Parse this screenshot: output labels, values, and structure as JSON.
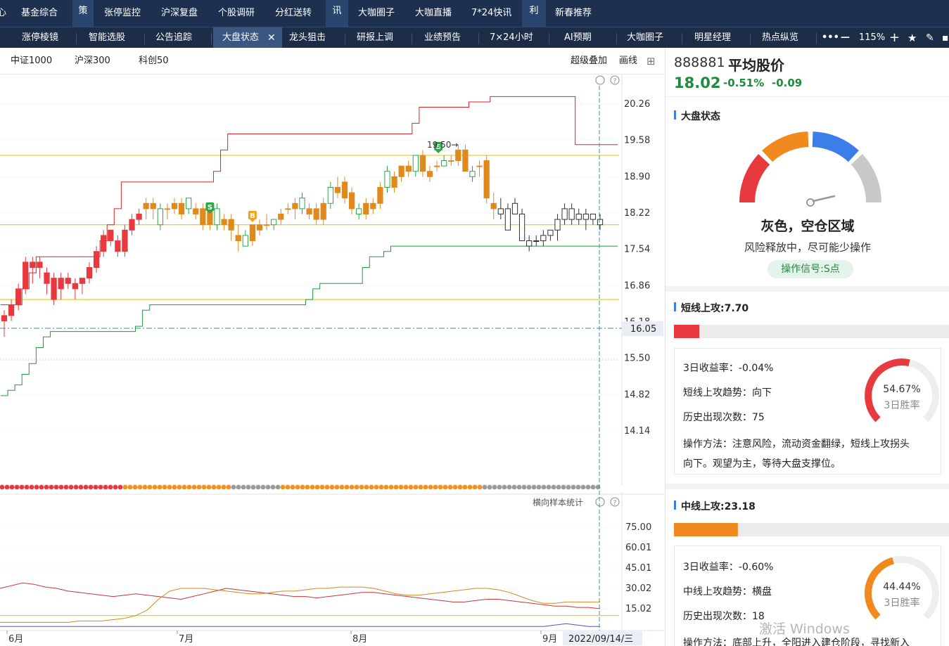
{
  "top_nav": {
    "cut_left": "心",
    "items": [
      "基金综合",
      "张停监控",
      "沪深复盘",
      "个股调研",
      "分红送转",
      "大咖圈子",
      "大咖直播",
      "7*24快讯",
      "新春推荐"
    ],
    "groups": [
      "策",
      "讯",
      "利"
    ]
  },
  "sub_nav": {
    "tabs": [
      "涨停棱镜",
      "智能选股",
      "公告追踪",
      "大盘状态",
      "龙头狙击",
      "研报上调",
      "业绩预告",
      "7×24小时",
      "AI预期",
      "大咖圈子",
      "明星经理",
      "热点纵览"
    ],
    "active_tab": "大盘状态",
    "more": "•••",
    "zoom_out": "—",
    "zoom": "115%",
    "zoom_in": "+"
  },
  "index_bar": {
    "indices": [
      "中证1000",
      "沪深300",
      "科创50"
    ],
    "overlay": "超级叠加",
    "draw": "画线"
  },
  "chart_data": [
    {
      "type": "candlestick",
      "ylim": [
        14.0,
        20.6
      ],
      "y_ticks": [
        "20.26",
        "19.58",
        "18.90",
        "18.22",
        "17.54",
        "16.86",
        "16.18",
        "15.50",
        "14.82",
        "14.14"
      ],
      "current_price_label": "16.05",
      "peak_annotation": "19.50→",
      "signals": [
        "S",
        "B",
        "S"
      ],
      "ohlc": [
        [
          16.2,
          16.4,
          15.9,
          16.3
        ],
        [
          16.3,
          16.6,
          16.2,
          16.5
        ],
        [
          16.5,
          16.9,
          16.4,
          16.8
        ],
        [
          16.8,
          17.4,
          16.7,
          17.3
        ],
        [
          17.3,
          17.4,
          16.9,
          17.2
        ],
        [
          17.3,
          17.4,
          17.0,
          17.2
        ],
        [
          17.1,
          17.2,
          16.7,
          16.9
        ],
        [
          17.0,
          17.1,
          16.5,
          16.6
        ],
        [
          16.8,
          17.1,
          16.6,
          17.0
        ],
        [
          17.0,
          17.1,
          16.8,
          16.9
        ],
        [
          16.9,
          17.0,
          16.6,
          16.8
        ],
        [
          16.9,
          17.0,
          16.7,
          17.0
        ],
        [
          17.0,
          17.3,
          16.9,
          17.2
        ],
        [
          17.2,
          17.6,
          17.1,
          17.5
        ],
        [
          17.5,
          17.9,
          17.4,
          17.8
        ],
        [
          17.9,
          17.9,
          17.6,
          17.7
        ],
        [
          17.7,
          17.8,
          17.4,
          17.5
        ],
        [
          17.5,
          18.0,
          17.4,
          17.9
        ],
        [
          17.9,
          18.2,
          17.8,
          18.1
        ],
        [
          18.1,
          18.3,
          18.0,
          18.2
        ],
        [
          18.3,
          18.5,
          18.1,
          18.4
        ],
        [
          18.4,
          18.5,
          18.1,
          18.3
        ],
        [
          18.0,
          18.4,
          17.9,
          18.3
        ],
        [
          18.3,
          18.4,
          18.1,
          18.3
        ],
        [
          18.3,
          18.5,
          18.2,
          18.4
        ],
        [
          18.4,
          18.5,
          18.1,
          18.2
        ],
        [
          18.3,
          18.5,
          18.2,
          18.5
        ],
        [
          18.3,
          18.4,
          18.1,
          18.2
        ],
        [
          18.0,
          18.4,
          17.9,
          18.3
        ],
        [
          18.3,
          18.4,
          17.9,
          18.0
        ],
        [
          18.0,
          18.4,
          17.9,
          18.3
        ],
        [
          18.1,
          18.2,
          17.9,
          18.0
        ],
        [
          18.1,
          18.2,
          17.7,
          17.9
        ],
        [
          17.8,
          18.0,
          17.5,
          17.7
        ],
        [
          17.6,
          17.9,
          17.6,
          17.8
        ],
        [
          17.7,
          18.0,
          17.6,
          18.0
        ],
        [
          17.9,
          18.1,
          17.8,
          18.0
        ],
        [
          18.0,
          18.2,
          17.9,
          18.0
        ],
        [
          18.0,
          18.1,
          17.9,
          18.1
        ],
        [
          18.1,
          18.3,
          18.0,
          18.2
        ],
        [
          18.3,
          18.4,
          18.2,
          18.3
        ],
        [
          18.3,
          18.5,
          18.1,
          18.4
        ],
        [
          18.5,
          18.6,
          18.2,
          18.3
        ],
        [
          18.2,
          18.4,
          18.1,
          18.3
        ],
        [
          18.3,
          18.4,
          18.0,
          18.1
        ],
        [
          18.1,
          18.5,
          18.0,
          18.4
        ],
        [
          18.4,
          18.8,
          18.3,
          18.7
        ],
        [
          18.6,
          18.9,
          18.5,
          18.7
        ],
        [
          18.8,
          18.9,
          18.4,
          18.5
        ],
        [
          18.6,
          18.7,
          18.2,
          18.3
        ],
        [
          18.3,
          18.4,
          18.1,
          18.2
        ],
        [
          18.2,
          18.5,
          18.1,
          18.4
        ],
        [
          18.3,
          18.5,
          18.2,
          18.4
        ],
        [
          18.4,
          18.8,
          18.3,
          18.7
        ],
        [
          18.7,
          19.1,
          18.6,
          19.0
        ],
        [
          18.7,
          19.0,
          18.6,
          18.9
        ],
        [
          18.9,
          19.1,
          18.8,
          19.1
        ],
        [
          19.1,
          19.2,
          18.9,
          19.0
        ],
        [
          19.0,
          19.3,
          18.9,
          19.3
        ],
        [
          19.3,
          19.4,
          18.9,
          19.0
        ],
        [
          19.0,
          19.1,
          18.8,
          18.9
        ],
        [
          19.1,
          19.2,
          19.0,
          19.1
        ],
        [
          19.1,
          19.3,
          19.1,
          19.2
        ],
        [
          19.2,
          19.3,
          19.1,
          19.2
        ],
        [
          19.4,
          19.5,
          19.1,
          19.2
        ],
        [
          19.4,
          19.5,
          19.0,
          19.0
        ],
        [
          19.0,
          19.1,
          18.8,
          18.9
        ],
        [
          19.1,
          19.2,
          18.9,
          19.1
        ],
        [
          19.2,
          19.3,
          18.4,
          18.5
        ],
        [
          18.4,
          18.6,
          18.1,
          18.3
        ],
        [
          18.3,
          18.5,
          18.1,
          18.2
        ],
        [
          18.3,
          18.4,
          17.9,
          17.9
        ],
        [
          18.4,
          18.5,
          18.2,
          18.2
        ],
        [
          18.2,
          18.3,
          17.7,
          17.7
        ],
        [
          17.7,
          17.8,
          17.5,
          17.6
        ],
        [
          17.7,
          17.8,
          17.6,
          17.7
        ],
        [
          17.7,
          17.9,
          17.6,
          17.8
        ],
        [
          17.8,
          17.9,
          17.7,
          17.9
        ],
        [
          17.9,
          18.2,
          17.7,
          18.1
        ],
        [
          18.1,
          18.4,
          18.0,
          18.3
        ],
        [
          18.3,
          18.4,
          18.0,
          18.1
        ],
        [
          18.1,
          18.3,
          18.0,
          18.2
        ],
        [
          18.2,
          18.3,
          17.9,
          18.1
        ],
        [
          18.1,
          18.2,
          18.0,
          18.2
        ],
        [
          18.1,
          18.2,
          17.9,
          18.0
        ]
      ],
      "upper_band": [
        16.5,
        16.5,
        16.5,
        16.8,
        17.1,
        17.4,
        17.4,
        17.4,
        17.4,
        17.4,
        17.4,
        17.4,
        17.4,
        17.4,
        17.7,
        18.0,
        18.3,
        18.8,
        18.8,
        18.8,
        18.8,
        18.8,
        18.8,
        18.8,
        18.8,
        18.8,
        18.8,
        18.8,
        18.8,
        18.8,
        19.0,
        19.4,
        19.7,
        19.7,
        19.7,
        19.7,
        19.7,
        19.7,
        19.7,
        19.7,
        19.7,
        19.7,
        19.7,
        19.7,
        19.7,
        19.7,
        19.7,
        19.7,
        19.7,
        19.7,
        19.7,
        19.7,
        19.7,
        19.7,
        19.7,
        19.7,
        19.7,
        19.7,
        19.9,
        20.2,
        20.2,
        20.2,
        20.2,
        20.2,
        20.2,
        20.2,
        20.3,
        20.3,
        20.3,
        20.4,
        20.4,
        20.4,
        20.4,
        20.4,
        20.4,
        20.4,
        20.4,
        20.4,
        20.4,
        20.4,
        20.4,
        19.5,
        19.5,
        19.5,
        19.5,
        19.5,
        19.5
      ],
      "lower_band": [
        14.8,
        14.9,
        15.0,
        15.2,
        15.4,
        15.7,
        15.9,
        16.0,
        16.0,
        16.0,
        16.0,
        16.0,
        16.0,
        16.0,
        16.0,
        16.0,
        16.0,
        16.0,
        16.0,
        16.1,
        16.4,
        16.5,
        16.5,
        16.5,
        16.5,
        16.5,
        16.5,
        16.5,
        16.5,
        16.5,
        16.5,
        16.5,
        16.5,
        16.5,
        16.5,
        16.5,
        16.5,
        16.5,
        16.5,
        16.5,
        16.5,
        16.5,
        16.5,
        16.6,
        16.8,
        16.9,
        16.9,
        16.9,
        16.9,
        16.9,
        16.9,
        17.2,
        17.4,
        17.4,
        17.5,
        17.6,
        17.6,
        17.6,
        17.6,
        17.6,
        17.6,
        17.6,
        17.6,
        17.6,
        17.6,
        17.6,
        17.6,
        17.6,
        17.6,
        17.6,
        17.6,
        17.6,
        17.6,
        17.6,
        17.6,
        17.6,
        17.6,
        17.6,
        17.6,
        17.6,
        17.6,
        17.6,
        17.6,
        17.6,
        17.6,
        17.6,
        17.6
      ],
      "hlines": [
        19.3,
        18.0,
        16.6
      ]
    },
    {
      "type": "line",
      "title": "横向样本统计",
      "y_ticks": [
        "75.00",
        "60.01",
        "45.01",
        "30.02",
        "15.02"
      ],
      "ylim": [
        0,
        85
      ],
      "x_labels": [
        "6月",
        "7月",
        "8月",
        "9月"
      ],
      "current_date": "2022/09/14/三",
      "series": [
        {
          "color": "#cc3333",
          "values": [
            30,
            32,
            34,
            33,
            31,
            30,
            28,
            27,
            26,
            25,
            24,
            25,
            26,
            25,
            24,
            23,
            22,
            24,
            26,
            28,
            30,
            29,
            28,
            27,
            26,
            25,
            24,
            24,
            23,
            24,
            25,
            26,
            27,
            27,
            26,
            25,
            24,
            23,
            22,
            21,
            20,
            20,
            21,
            22,
            22,
            21,
            20,
            19,
            18,
            17,
            17,
            16,
            16,
            15
          ]
        },
        {
          "color": "#d08a1e",
          "values": [
            5,
            5,
            5,
            5,
            5,
            5,
            5,
            6,
            6,
            6,
            7,
            8,
            10,
            14,
            22,
            28,
            30,
            30,
            30,
            29,
            28,
            27,
            26,
            26,
            27,
            28,
            28,
            29,
            30,
            30,
            31,
            31,
            31,
            30,
            28,
            26,
            25,
            25,
            26,
            27,
            28,
            29,
            30,
            30,
            29,
            27,
            24,
            21,
            19,
            19,
            20,
            20,
            20,
            20
          ]
        },
        {
          "color": "#4a57c8",
          "values": [
            2,
            2,
            2,
            2,
            2,
            2,
            2,
            2,
            2,
            2,
            2,
            2,
            2,
            2,
            2,
            2,
            2,
            2,
            2,
            2,
            2,
            2,
            2,
            2,
            2,
            2,
            2,
            2,
            2,
            2,
            2,
            2,
            2,
            2,
            2,
            2,
            2,
            2,
            2,
            2,
            2,
            2,
            2,
            2,
            2,
            2,
            2,
            2,
            2,
            3,
            4,
            3,
            2,
            2
          ]
        }
      ],
      "hline": 10,
      "dots": [
        "r",
        "r",
        "r",
        "r",
        "r",
        "r",
        "r",
        "r",
        "r",
        "r",
        "r",
        "r",
        "r",
        "r",
        "r",
        "r",
        "r",
        "r",
        "r",
        "r",
        "r",
        "r",
        "r",
        "r",
        "r",
        "r",
        "o",
        "o",
        "o",
        "o",
        "o",
        "o",
        "o",
        "o",
        "o",
        "o",
        "o",
        "o",
        "o",
        "o",
        "o",
        "o",
        "o",
        "g",
        "g",
        "g",
        "g",
        "g",
        "g",
        "g",
        "g",
        "g",
        "g",
        "o",
        "o",
        "o",
        "o",
        "o",
        "o",
        "o",
        "o",
        "o",
        "o",
        "o",
        "o",
        "o",
        "o",
        "o",
        "o",
        "o",
        "o",
        "o",
        "o",
        "o",
        "o",
        "o",
        "o",
        "o",
        "o",
        "o",
        "o",
        "o",
        "o",
        "o",
        "o",
        "o",
        "o",
        "o",
        "o",
        "o",
        "o",
        "o",
        "o",
        "o",
        "o",
        "o",
        "o",
        "o",
        "o",
        "o",
        "g",
        "g",
        "g",
        "g",
        "g",
        "g",
        "g",
        "g",
        "g",
        "g",
        "g",
        "g",
        "g",
        "g",
        "g",
        "g",
        "g",
        "g",
        "g",
        "g",
        "g",
        "g",
        "g"
      ]
    }
  ],
  "stock": {
    "code": "888881",
    "name": "平均股价",
    "price": "18.02",
    "pct": "-0.51%",
    "change": "-0.09"
  },
  "market_status": {
    "section_title": "大盘状态",
    "state": "灰色，空仓区域",
    "desc": "风险释放中，尽可能少操作",
    "signal": "操作信号:S点"
  },
  "short_attack": {
    "title": "短线上攻:7.70",
    "bar_value": 0.077,
    "lines": [
      "3日收益率：-0.04%",
      "短线上攻趋势：向下",
      "历史出现次数：75"
    ],
    "method_l1": "操作方法：注意风险，流动资金翻绿，短线上攻拐头",
    "method_l2": "向下。观望为主，等待大盘支撑位。",
    "win_rate": "54.67%",
    "win_label": "3日胜率",
    "win_fraction": 0.5467
  },
  "mid_attack": {
    "title": "中线上攻:23.18",
    "bar_value": 0.2318,
    "lines": [
      "3日收益率：-0.60%",
      "中线上攻趋势：横盘",
      "历史出现次数：18"
    ],
    "method_l1": "操作方法：底部上升，全阳进入建仓阶段，寻找新入",
    "win_rate": "44.44%",
    "win_label": "3日胜率",
    "win_fraction": 0.4444
  },
  "watermark": "激活 Windows",
  "colors": {
    "red": "#e8393e",
    "orange": "#f08a1e",
    "blue": "#3b7de9",
    "gray": "#c8c8c8",
    "green": "#1f8b3e",
    "nav_bg": "#1e3050"
  }
}
